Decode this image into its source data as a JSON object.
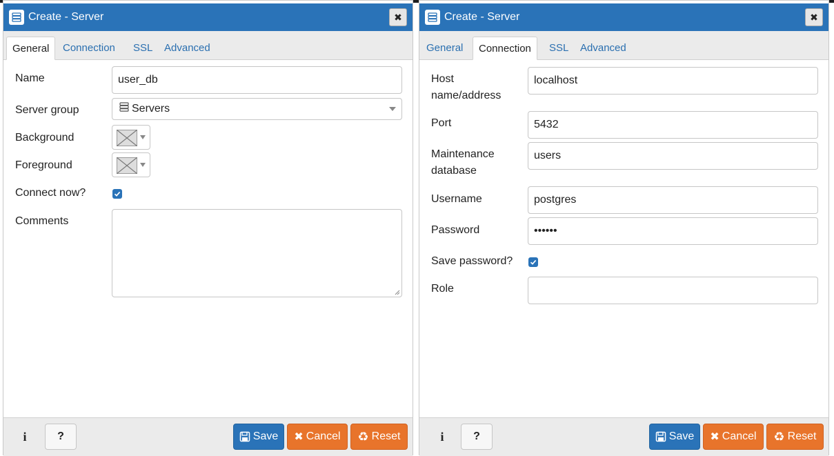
{
  "colors": {
    "titlebar": "#2a73b8",
    "accent_orange": "#e8742b",
    "link": "#2a6fb0"
  },
  "left": {
    "title": "Create - Server",
    "tabs": [
      {
        "label": "General",
        "active": true
      },
      {
        "label": "Connection",
        "active": false
      },
      {
        "label": "SSL",
        "active": false
      },
      {
        "label": "Advanced",
        "active": false
      }
    ],
    "fields": {
      "name_label": "Name",
      "name_value": "user_db",
      "server_group_label": "Server group",
      "server_group_value": "Servers",
      "background_label": "Background",
      "foreground_label": "Foreground",
      "connect_now_label": "Connect now?",
      "connect_now_checked": true,
      "comments_label": "Comments",
      "comments_value": ""
    },
    "footer": {
      "info": "i",
      "help": "?",
      "save": "Save",
      "cancel": "Cancel",
      "reset": "Reset"
    }
  },
  "right": {
    "title": "Create - Server",
    "tabs": [
      {
        "label": "General",
        "active": false
      },
      {
        "label": "Connection",
        "active": true
      },
      {
        "label": "SSL",
        "active": false
      },
      {
        "label": "Advanced",
        "active": false
      }
    ],
    "fields": {
      "host_label_1": "Host",
      "host_label_2": "name/address",
      "host_value": "localhost",
      "port_label": "Port",
      "port_value": "5432",
      "maint_label_1": "Maintenance",
      "maint_label_2": "database",
      "maint_value": "users",
      "username_label": "Username",
      "username_value": "postgres",
      "password_label": "Password",
      "password_value": "••••••",
      "save_password_label": "Save password?",
      "save_password_checked": true,
      "role_label": "Role",
      "role_value": ""
    },
    "footer": {
      "info": "i",
      "help": "?",
      "save": "Save",
      "cancel": "Cancel",
      "reset": "Reset"
    }
  }
}
